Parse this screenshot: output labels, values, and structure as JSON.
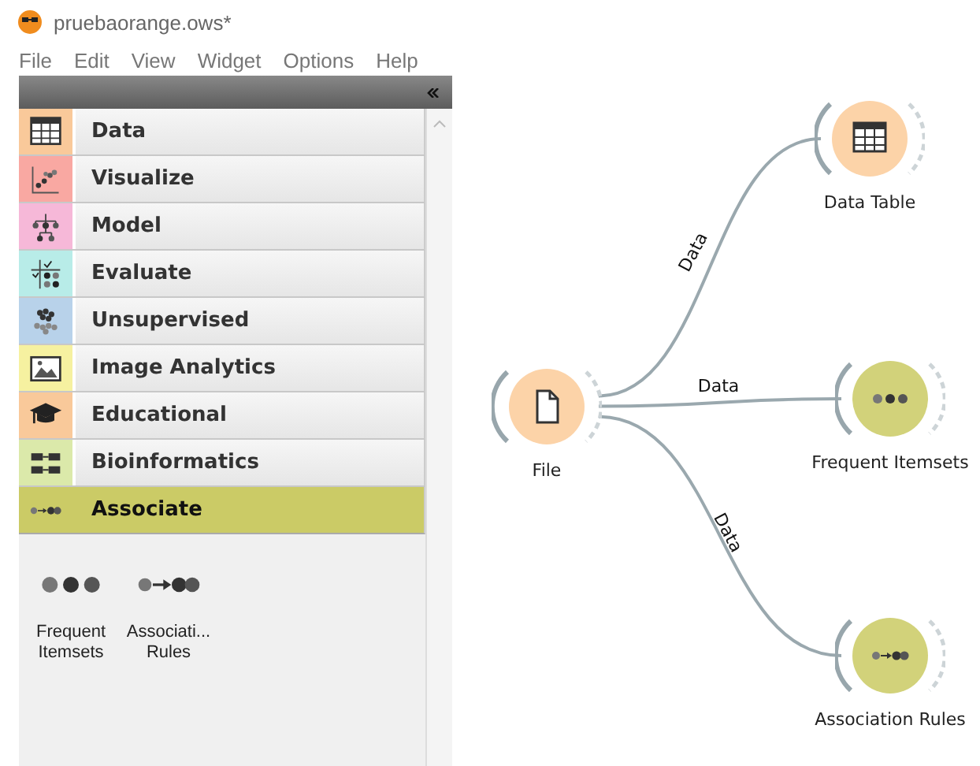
{
  "window": {
    "title": "pruebaorange.ows*"
  },
  "menu": [
    "File",
    "Edit",
    "View",
    "Widget",
    "Options",
    "Help"
  ],
  "toolbox": {
    "categories": [
      {
        "label": "Data",
        "kind": "table",
        "color": "#f9c99a",
        "selected": false
      },
      {
        "label": "Visualize",
        "kind": "scatter",
        "color": "#f9a8a2",
        "selected": false
      },
      {
        "label": "Model",
        "kind": "tree",
        "color": "#f6b8d8",
        "selected": false
      },
      {
        "label": "Evaluate",
        "kind": "matrix",
        "color": "#b8ece8",
        "selected": false
      },
      {
        "label": "Unsupervised",
        "kind": "cluster",
        "color": "#b8d2ea",
        "selected": false
      },
      {
        "label": "Image Analytics",
        "kind": "image",
        "color": "#f6f1a0",
        "selected": false
      },
      {
        "label": "Educational",
        "kind": "cap",
        "color": "#f9c99a",
        "selected": false
      },
      {
        "label": "Bioinformatics",
        "kind": "blocks",
        "color": "#dbe9aa",
        "selected": false
      },
      {
        "label": "Associate",
        "kind": "dots-arrow",
        "color": "#cbcb66",
        "selected": true
      }
    ],
    "widgets": [
      {
        "label": "Frequent Itemsets",
        "kind": "dots"
      },
      {
        "label": "Associati... Rules",
        "kind": "dots-arrow"
      }
    ]
  },
  "canvas": {
    "nodes": [
      {
        "label": "Data Table",
        "kind": "table",
        "color": "#fcd3a8"
      },
      {
        "label": "File",
        "kind": "file",
        "color": "#fcd3a8"
      },
      {
        "label": "Frequent Itemsets",
        "kind": "dots",
        "color": "#d2d27a"
      },
      {
        "label": "Association Rules",
        "kind": "dots-arrow",
        "color": "#d2d27a"
      }
    ],
    "links": [
      {
        "label": "Data"
      },
      {
        "label": "Data"
      },
      {
        "label": "Data"
      }
    ]
  }
}
